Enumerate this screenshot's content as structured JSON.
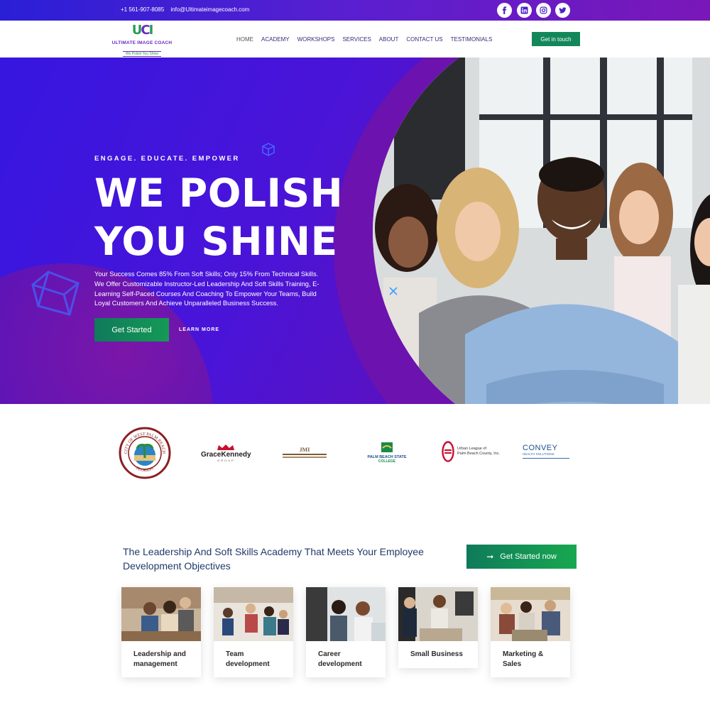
{
  "topbar": {
    "phone": "+1 561-907-8085",
    "email": "info@Ultimateimagecoach.com",
    "social": [
      "facebook-icon",
      "linkedin-icon",
      "instagram-icon",
      "twitter-icon"
    ]
  },
  "logo": {
    "mark_u": "U",
    "mark_c": "C",
    "mark_i": "I",
    "name": "ULTIMATE IMAGE COACH",
    "tagline": "We Polish You Shine"
  },
  "menu": [
    "HOME",
    "ACADEMY",
    "WORKSHOPS",
    "SERVICES",
    "ABOUT",
    "CONTACT US",
    "TESTIMONIALS"
  ],
  "cta_touch": "Get in touch",
  "hero": {
    "eyebrow": "ENGAGE. EDUCATE. EMPOWER",
    "title_line1": "WE POLISH",
    "title_line2": "YOU SHINE",
    "lead": "Your Success Comes 85% From Soft Skills; Only 15% From Technical Skills. We Offer Customizable Instructor-Led Leadership And Soft Skills Training, E-Learning Self-Paced Courses And Coaching To Empower Your Teams, Build Loyal Customers And Achieve Unparalleled Business Success.",
    "primary_button": "Get Started",
    "secondary_button": "LEARN MORE"
  },
  "clients": {
    "west_palm": {
      "ring_top": "CITY OF WEST PALM BEACH",
      "ring_bottom": "FLORIDA"
    },
    "gracekennedy": {
      "name": "GraceKennedy",
      "sub": "GROUP"
    },
    "jmi": {
      "mark": "JMI"
    },
    "pbsc": {
      "line1": "PALM BEACH STATE",
      "line2": "COLLEGE"
    },
    "urban_league": {
      "line1": "Urban League of",
      "line2": "Palm Beach County, Inc."
    },
    "convey": {
      "name": "CONVEY",
      "sub": "HEALTH SOLUTIONS"
    }
  },
  "academy": {
    "title": "The Leadership And Soft Skills Academy That Meets Your Employee Development Objectives",
    "button": "Get Started now"
  },
  "cards": [
    {
      "label": "Leadership and management"
    },
    {
      "label": "Team development"
    },
    {
      "label": "Career development"
    },
    {
      "label": "Small Business"
    },
    {
      "label": "Marketing & Sales"
    }
  ],
  "colors": {
    "brand_purple": "#5a1fd0",
    "brand_green": "#14875a",
    "heading_blue": "#1f3a6a"
  }
}
